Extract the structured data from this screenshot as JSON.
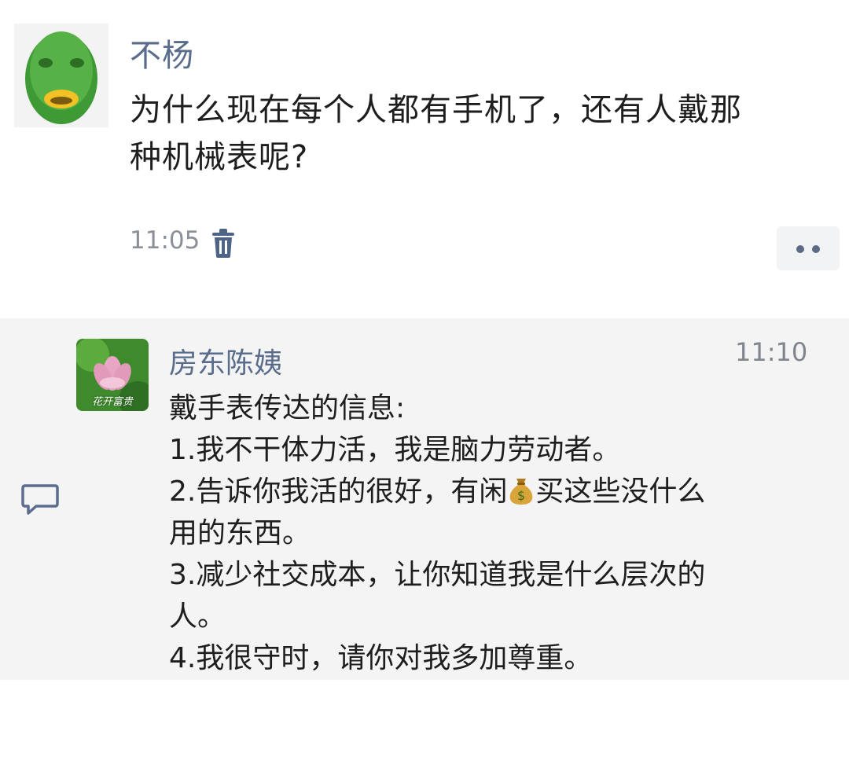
{
  "post": {
    "author": "不杨",
    "text_lines": [
      "为什么现在每个人都有手机了，还有人戴那",
      "种机械表呢?"
    ],
    "time": "11:05",
    "icons": {
      "avatar": "green-fish-mask-avatar",
      "delete": "trash-icon",
      "more": "more-dots-icon"
    }
  },
  "comment": {
    "author": "房东陈姨",
    "time": "11:10",
    "avatar_caption": "花开富贵",
    "lines": [
      "戴手表传达的信息:",
      "1.我不干体力活，我是脑力劳动者。",
      "2.告诉你我活的很好，有闲",
      "买这些没什么",
      "用的东西。",
      "3.减少社交成本，让你知道我是什么层次的",
      "人。",
      "4.我很守时，请你对我多加尊重。"
    ],
    "icons": {
      "comment": "comment-bubble-icon",
      "avatar": "lotus-avatar",
      "emoji": "money-bag-emoji"
    }
  },
  "colors": {
    "name": "#5a6c8c",
    "text": "#1e1e1e",
    "meta": "#8a8f98",
    "comment_bg": "#f4f4f4"
  }
}
